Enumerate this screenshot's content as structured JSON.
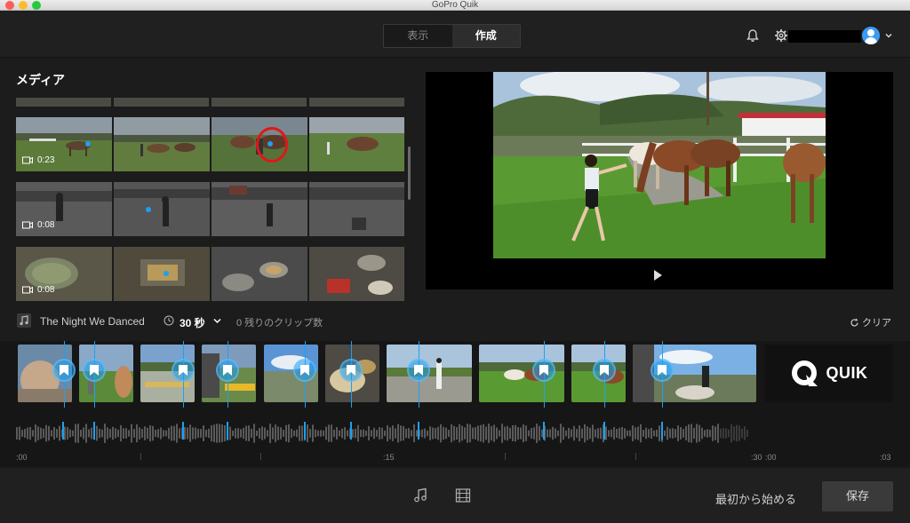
{
  "window": {
    "title": "GoPro Quik"
  },
  "header": {
    "tabs": [
      {
        "label": "表示"
      },
      {
        "label": "作成"
      }
    ],
    "icons": [
      "bell-icon",
      "gear-icon",
      "avatar-icon",
      "chevron-down-icon"
    ]
  },
  "media": {
    "title": "メディア",
    "clips": [
      {
        "duration": "0:23"
      },
      {
        "duration": "0:08"
      },
      {
        "duration": "0:08"
      }
    ]
  },
  "music": {
    "song": "The Night We Danced",
    "duration": "30 秒",
    "remaining": "0 残りのクリップ数",
    "clear_label": "クリア"
  },
  "timeline": {
    "brand": "QUIK",
    "ruler": [
      ":00",
      ":15",
      ":30",
      ":00",
      ":03"
    ]
  },
  "footer": {
    "restart_label": "最初から始める",
    "save_label": "保存"
  },
  "colors": {
    "accent": "#1ea0f0",
    "highlight_circle": "#e0161a",
    "background": "#1c1c1c"
  }
}
